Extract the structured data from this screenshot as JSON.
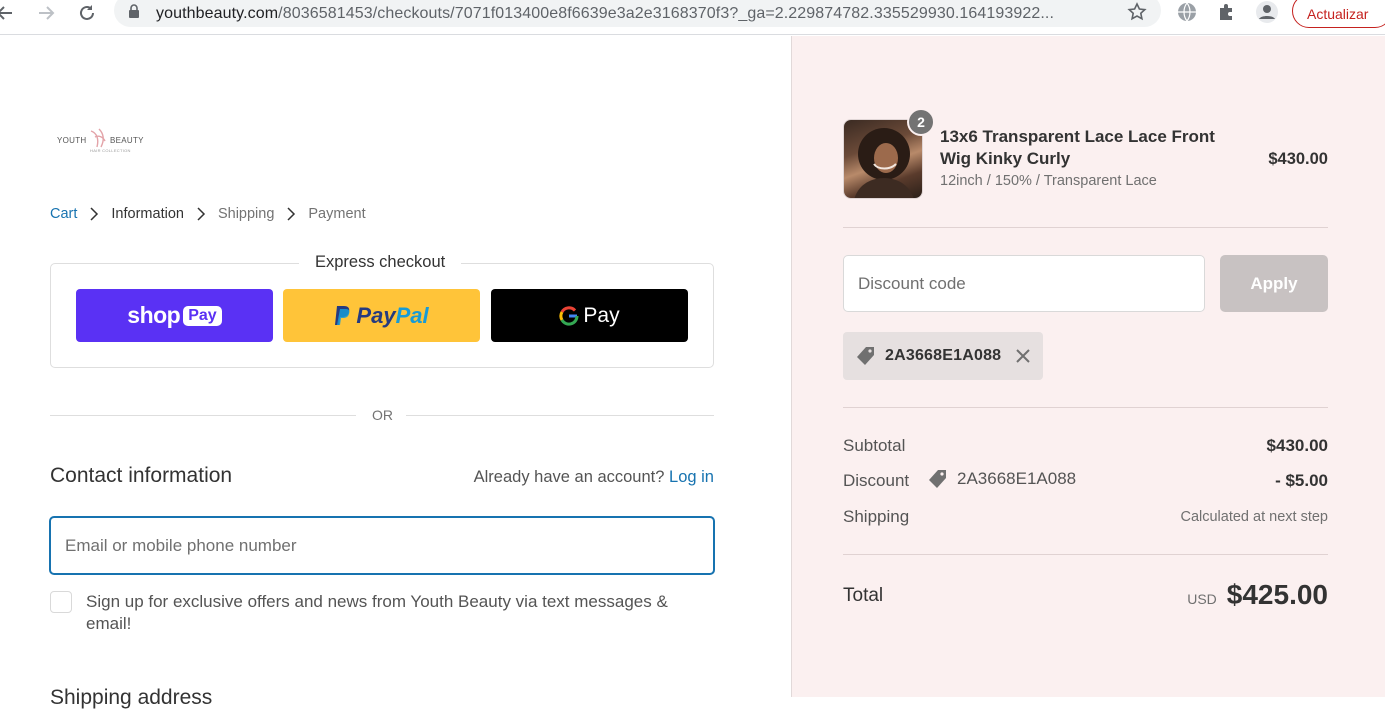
{
  "browser": {
    "url_domain": "youthbeauty.com",
    "url_path": "/8036581453/checkouts/7071f013400e8f6639e3a2e3168370f3?_ga=2.229874782.335529930.164193922...",
    "update_button": "Actualizar"
  },
  "store": {
    "logo_left": "YOUTH",
    "logo_right": "BEAUTY",
    "logo_sub": "HAIR COLLECTION"
  },
  "breadcrumb": {
    "cart": "Cart",
    "information": "Information",
    "shipping": "Shipping",
    "payment": "Payment"
  },
  "express": {
    "title": "Express checkout",
    "shop_pay": {
      "word": "shop",
      "badge": "Pay"
    },
    "paypal": {
      "part1": "Pay",
      "part2": "Pal"
    },
    "gpay": {
      "word": "Pay"
    }
  },
  "or_label": "OR",
  "contact": {
    "title": "Contact information",
    "account_prompt": "Already have an account?",
    "login": "Log in",
    "email_placeholder": "Email or mobile phone number",
    "optin_label": "Sign up for exclusive offers and news from Youth Beauty via text messages & email!"
  },
  "next_section": "Shipping address",
  "order": {
    "item": {
      "quantity": "2",
      "name": "13x6 Transparent Lace Lace Front Wig Kinky Curly",
      "variant": "12inch / 150% / Transparent Lace",
      "price": "$430.00"
    },
    "discount_placeholder": "Discount code",
    "apply_label": "Apply",
    "applied_code": "2A3668E1A088",
    "subtotal_label": "Subtotal",
    "subtotal_value": "$430.00",
    "discount_label": "Discount",
    "discount_code": "2A3668E1A088",
    "discount_value": "- $5.00",
    "shipping_label": "Shipping",
    "shipping_value": "Calculated at next step",
    "total_label": "Total",
    "currency": "USD",
    "total_value": "$425.00"
  },
  "colors": {
    "accent": "#1773b0",
    "shop_pay": "#5a31f4",
    "paypal": "#ffc439",
    "sidebar_bg": "#fbf0f0"
  }
}
